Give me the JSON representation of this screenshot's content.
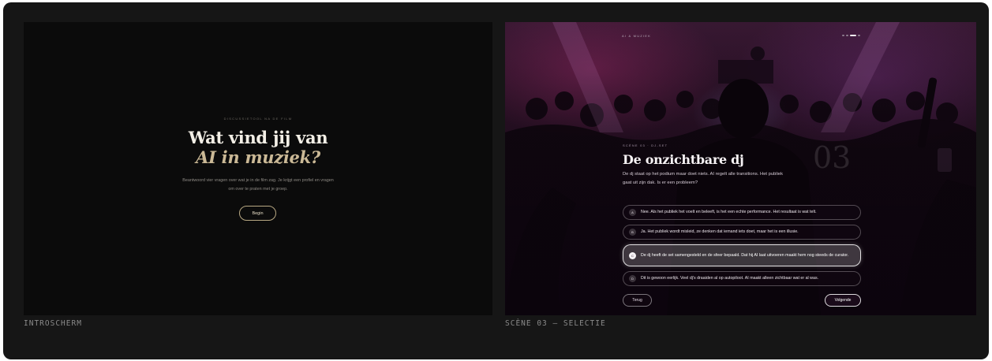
{
  "intro": {
    "eyebrow": "DISCUSSIETOOL NA DE FILM",
    "title_line1": "Wat vind jij van",
    "title_line2": "AI in muziek?",
    "body": "Beantwoord vier vragen over wat je in de film zag. Je krijgt een profiel en vragen om over te praten met je groep.",
    "begin_button": "Begin",
    "caption": "INTROSCHERM"
  },
  "scene": {
    "top_label": "AI & MUZIEK",
    "progress": {
      "total": 4,
      "current": 3
    },
    "eyebrow": "SCÈNE 03 · DJ-SET",
    "number": "03",
    "title": "De onzichtbare dj",
    "body": "De dj staat op het podium maar doet niets. AI regelt alle transitions. Het publiek gaat uit zijn dak. Is er een probleem?",
    "options": [
      {
        "letter": "A",
        "text": "Nee. Als het publiek het voelt en beleeft, is het een echte performance. Het resultaat is wat telt."
      },
      {
        "letter": "B",
        "text": "Ja. Het publiek wordt misleid, ze denken dat iemand iets doet, maar het is een illusie."
      },
      {
        "letter": "C",
        "text": "De dj heeft de set samengesteld en de sfeer bepaald. Dat hij AI laat uitvoeren maakt hem nog steeds de curator."
      },
      {
        "letter": "D",
        "text": "Dit is gewoon eerlijk. Veel dj's draaiden al op autopiloot. AI maakt alleen zichtbaar wat er al was."
      }
    ],
    "selected_option": "C",
    "back_button": "Terug",
    "next_button": "Volgende",
    "caption": "SCÈNE 03 — SELECTIE"
  }
}
